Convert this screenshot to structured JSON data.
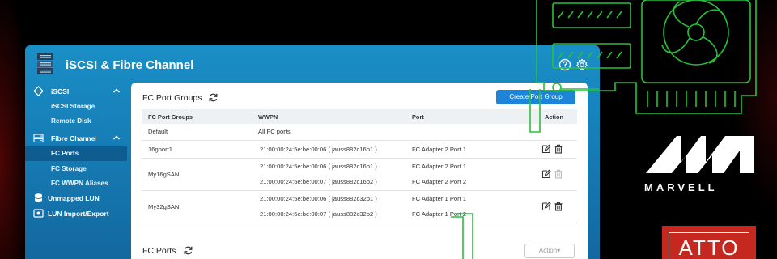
{
  "app": {
    "title": "iSCSI & Fibre Channel"
  },
  "sidebar": {
    "sections": [
      {
        "label": "iSCSI",
        "icon": "iscsi-icon",
        "children": [
          "iSCSI Storage",
          "Remote Disk"
        ]
      },
      {
        "label": "Fibre Channel",
        "icon": "fibre-channel-icon",
        "children": [
          "FC Ports",
          "FC Storage",
          "FC WWPN Aliases"
        ]
      }
    ],
    "items": [
      {
        "label": "Unmapped LUN",
        "icon": "database-icon"
      },
      {
        "label": "LUN Import/Export",
        "icon": "import-export-icon"
      }
    ],
    "active": "FC Ports"
  },
  "fc_port_groups": {
    "title": "FC Port Groups",
    "create_label": "Create Port Group",
    "columns": [
      "FC Port Groups",
      "WWPN",
      "Port",
      "Action"
    ],
    "rows": [
      {
        "group": "Default",
        "wwpns": [
          "All FC ports"
        ],
        "ports": [
          ""
        ]
      },
      {
        "group": "16gport1",
        "wwpns": [
          "21:00:00:24:5e:be:00:06 ( jauss882c16p1 )"
        ],
        "ports": [
          "FC Adapter 2 Port 1"
        ]
      },
      {
        "group": "My16gSAN",
        "wwpns": [
          "21:00:00:24:5e:be:00:06 ( jauss882c16p1 )",
          "21:00:00:24:5e:be:00:07 ( jauss882c16p2 )"
        ],
        "ports": [
          "FC Adapter 2 Port 1",
          "FC Adapter 2 Port 2"
        ]
      },
      {
        "group": "My32gSAN",
        "wwpns": [
          "21:00:00:24:5e:be:00:06 ( jauss882c32p1 )",
          "21:00:00:24:5e:be:00:07 ( jauss882c32p2 )"
        ],
        "ports": [
          "FC Adapter 1 Port 1",
          "FC Adapter 1 Port 2"
        ]
      }
    ]
  },
  "fc_ports": {
    "title": "FC Ports",
    "action_label": "Action▾"
  },
  "branding": {
    "marvell": "MARVELL",
    "atto": "ATTO"
  },
  "colors": {
    "accent": "#1d84d8",
    "window": "#1a8fc7",
    "pcb_green": "#27c23a",
    "atto_red": "#c5281f"
  }
}
